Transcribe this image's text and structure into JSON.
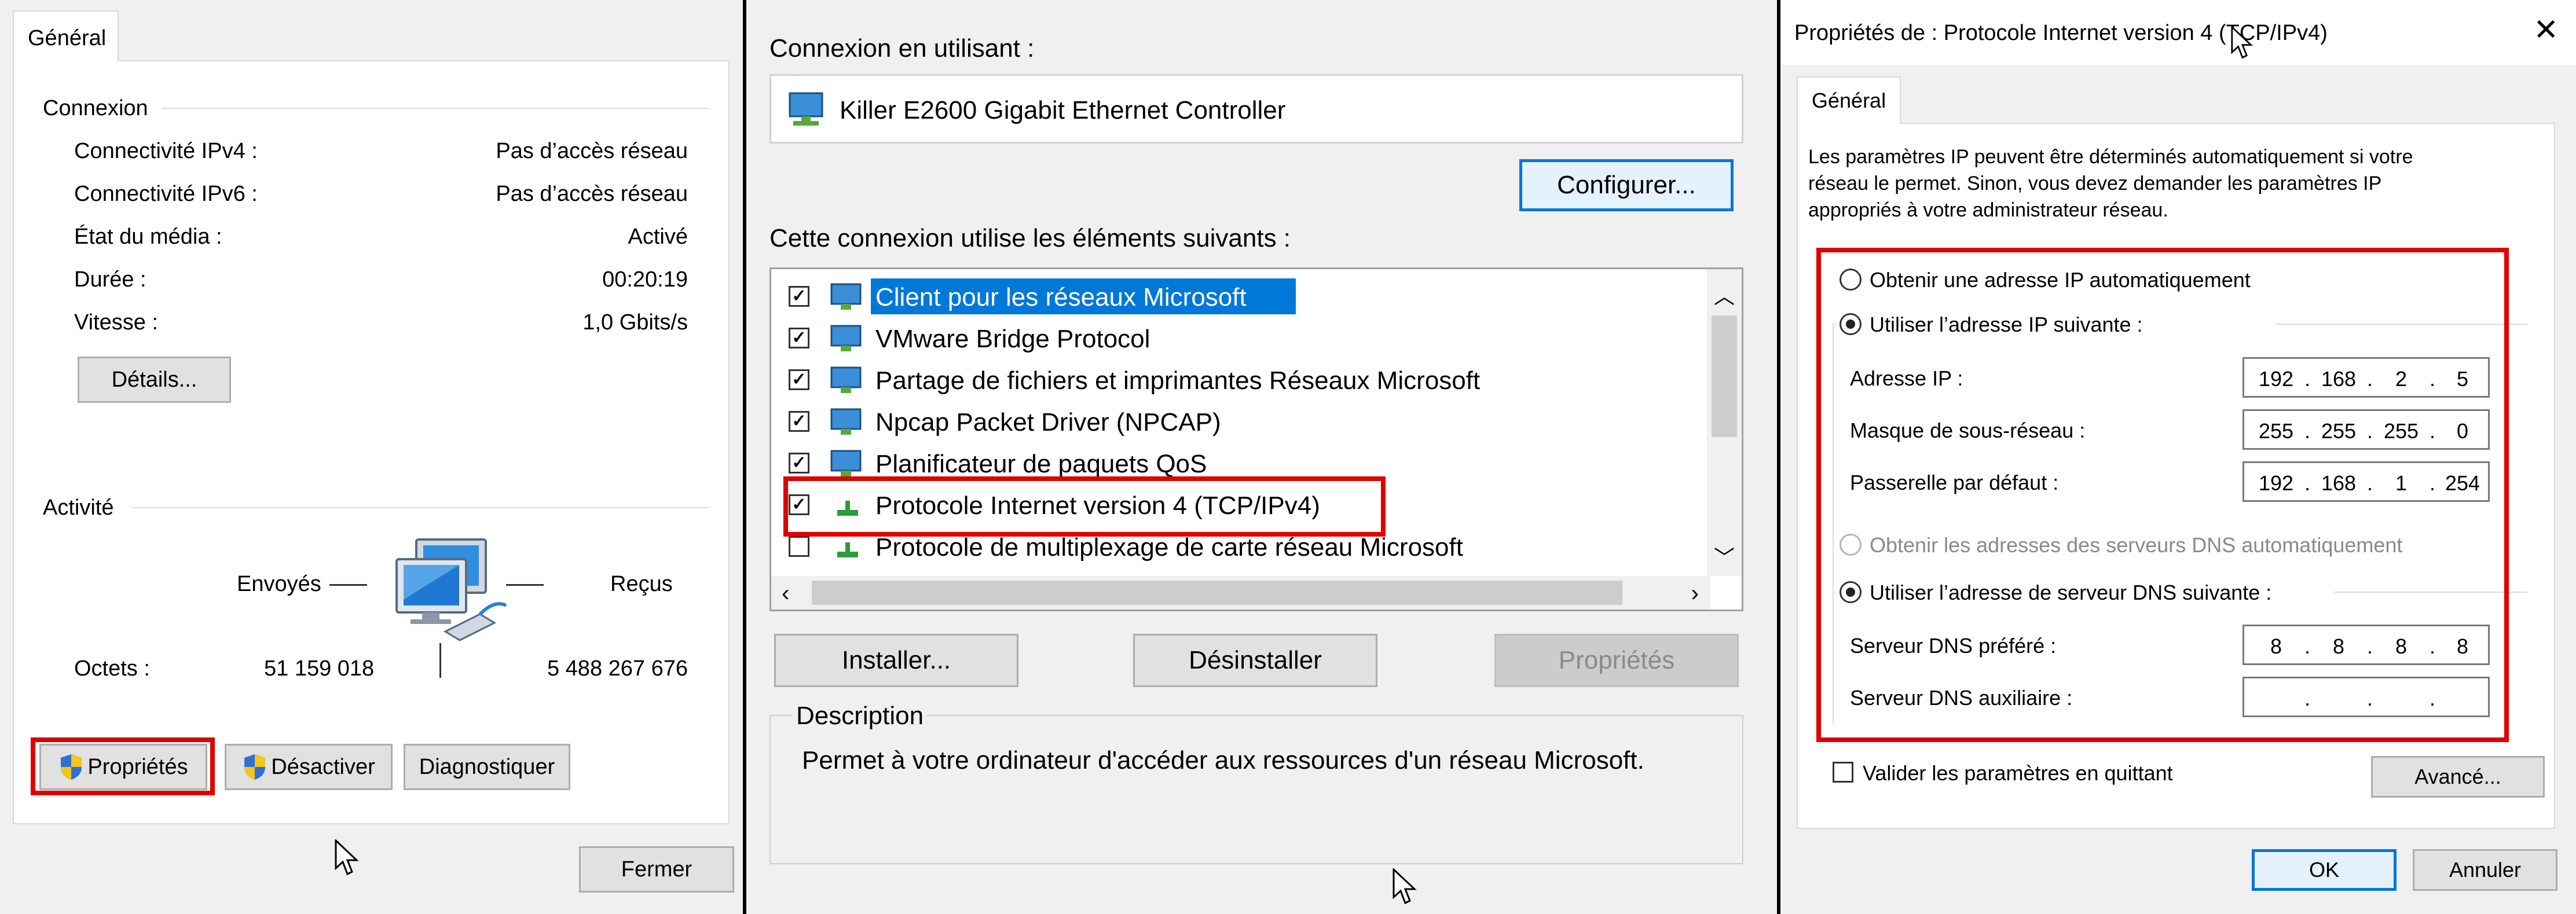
{
  "panel1": {
    "tab": "Général",
    "connexion_title": "Connexion",
    "rows": [
      {
        "label": "Connectivité IPv4 :",
        "value": "Pas d’accès réseau"
      },
      {
        "label": "Connectivité IPv6 :",
        "value": "Pas d’accès réseau"
      },
      {
        "label": "État du média :",
        "value": "Activé"
      },
      {
        "label": "Durée :",
        "value": "00:20:19"
      },
      {
        "label": "Vitesse :",
        "value": "1,0 Gbits/s"
      }
    ],
    "details_button": "Détails...",
    "activite_title": "Activité",
    "envoyes": "Envoyés",
    "recus": "Reçus",
    "octets_label": "Octets :",
    "octets_sent": "51 159 018",
    "octets_recv": "5 488 267 676",
    "btn_proprietes": "Propriétés",
    "btn_desactiver": "Désactiver",
    "btn_diagnostiquer": "Diagnostiquer",
    "btn_fermer": "Fermer"
  },
  "panel2": {
    "connect_using_label": "Connexion en utilisant :",
    "adapter_name": "Killer E2600 Gigabit Ethernet Controller",
    "configure_button": "Configurer...",
    "items_label": "Cette connexion utilise les éléments suivants :",
    "items": [
      {
        "label": "Client pour les réseaux Microsoft",
        "checked": true,
        "selected": true
      },
      {
        "label": "VMware Bridge Protocol",
        "checked": true
      },
      {
        "label": "Partage de fichiers et imprimantes Réseaux Microsoft",
        "checked": true
      },
      {
        "label": "Npcap Packet Driver (NPCAP)",
        "checked": true
      },
      {
        "label": "Planificateur de paquets QoS",
        "checked": true
      },
      {
        "label": "Protocole Internet version 4 (TCP/IPv4)",
        "checked": true,
        "highlighted": true
      },
      {
        "label": "Protocole de multiplexage de carte réseau Microsoft",
        "checked": false
      }
    ],
    "btn_installer": "Installer...",
    "btn_desinstaller": "Désinstaller",
    "btn_proprietes": "Propriétés",
    "description_title": "Description",
    "description_text": "Permet à votre ordinateur d'accéder aux ressources d'un réseau Microsoft."
  },
  "panel3": {
    "title": "Propriétés de : Protocole Internet version 4 (TCP/IPv4)",
    "tab": "Général",
    "intro": [
      "Les paramètres IP peuvent être déterminés automatiquement si votre",
      "réseau le permet. Sinon, vous devez demander les paramètres IP",
      "appropriés à votre administrateur réseau."
    ],
    "radio_auto_ip": "Obtenir une adresse IP automatiquement",
    "radio_manual_ip": "Utiliser l’adresse IP suivante :",
    "ip_label": "Adresse IP :",
    "ip": [
      "192",
      "168",
      "2",
      "5"
    ],
    "mask_label": "Masque de sous-réseau :",
    "mask": [
      "255",
      "255",
      "255",
      "0"
    ],
    "gateway_label": "Passerelle par défaut :",
    "gateway": [
      "192",
      "168",
      "1",
      "254"
    ],
    "radio_auto_dns": "Obtenir les adresses des serveurs DNS automatiquement",
    "radio_manual_dns": "Utiliser l’adresse de serveur DNS suivante :",
    "dns1_label": "Serveur DNS préféré :",
    "dns1": [
      "8",
      "8",
      "8",
      "8"
    ],
    "dns2_label": "Serveur DNS auxiliaire :",
    "dns2": [
      "",
      "",
      "",
      ""
    ],
    "validate_label": "Valider les paramètres en quittant",
    "btn_avance": "Avancé...",
    "btn_ok": "OK",
    "btn_annuler": "Annuler"
  },
  "colors": {
    "highlight_red": "#e00000",
    "selection_blue": "#0078d7",
    "dialog_bg": "#f0f0f0"
  }
}
